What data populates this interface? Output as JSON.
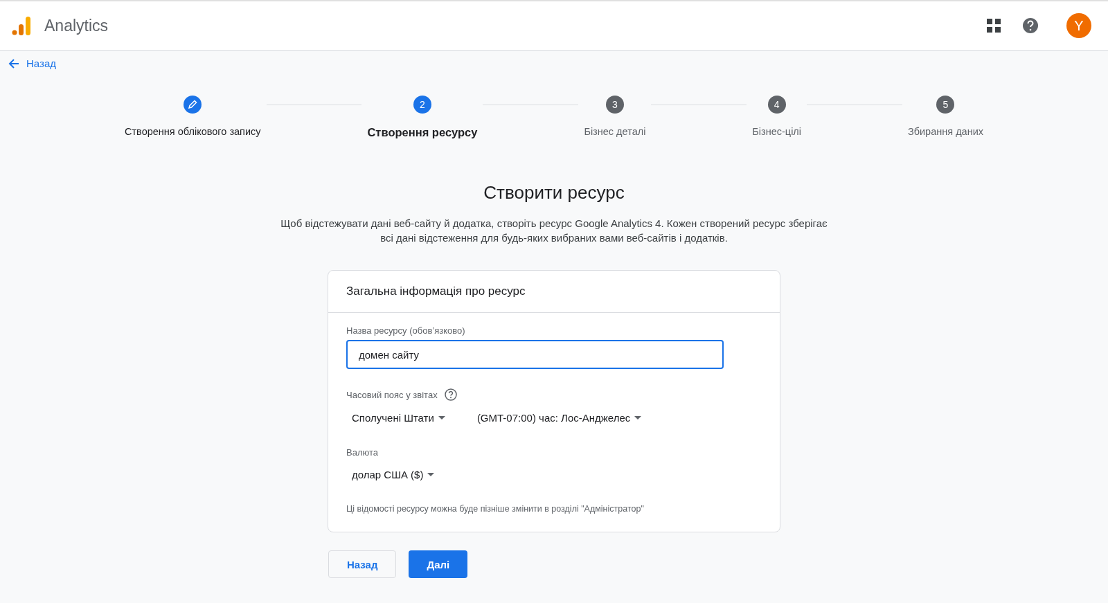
{
  "header": {
    "app_name": "Analytics",
    "avatar_letter": "Y"
  },
  "back_link": "Назад",
  "steps": [
    {
      "label": "Створення облікового запису",
      "kind": "done"
    },
    {
      "number": "2",
      "label": "Створення ресурсу",
      "kind": "active"
    },
    {
      "number": "3",
      "label": "Бізнес деталі",
      "kind": "pending"
    },
    {
      "number": "4",
      "label": "Бізнес-цілі",
      "kind": "pending"
    },
    {
      "number": "5",
      "label": "Збирання даних",
      "kind": "pending"
    }
  ],
  "title": "Створити ресурс",
  "description": "Щоб відстежувати дані веб-сайту й додатка, створіть ресурс Google Analytics 4. Кожен створений ресурс зберігає всі дані відстеження для будь-яких вибраних вами веб-сайтів і додатків.",
  "card": {
    "title": "Загальна інформація про ресурс",
    "name_field": {
      "label": "Назва ресурсу (обов’язково)",
      "value": "домен сайту"
    },
    "timezone": {
      "label": "Часовий пояс у звітах",
      "country": "Сполучені Штати",
      "zone": "(GMT-07:00) час: Лос-Анджелес"
    },
    "currency": {
      "label": "Валюта",
      "value": "долар США ($)"
    },
    "note": "Ці відомості ресурсу можна буде пізніше змінити в розділі \"Адміністратор\""
  },
  "buttons": [
    {
      "label": "Назад",
      "kind": "secondary"
    },
    {
      "label": "Далі",
      "kind": "primary"
    }
  ]
}
